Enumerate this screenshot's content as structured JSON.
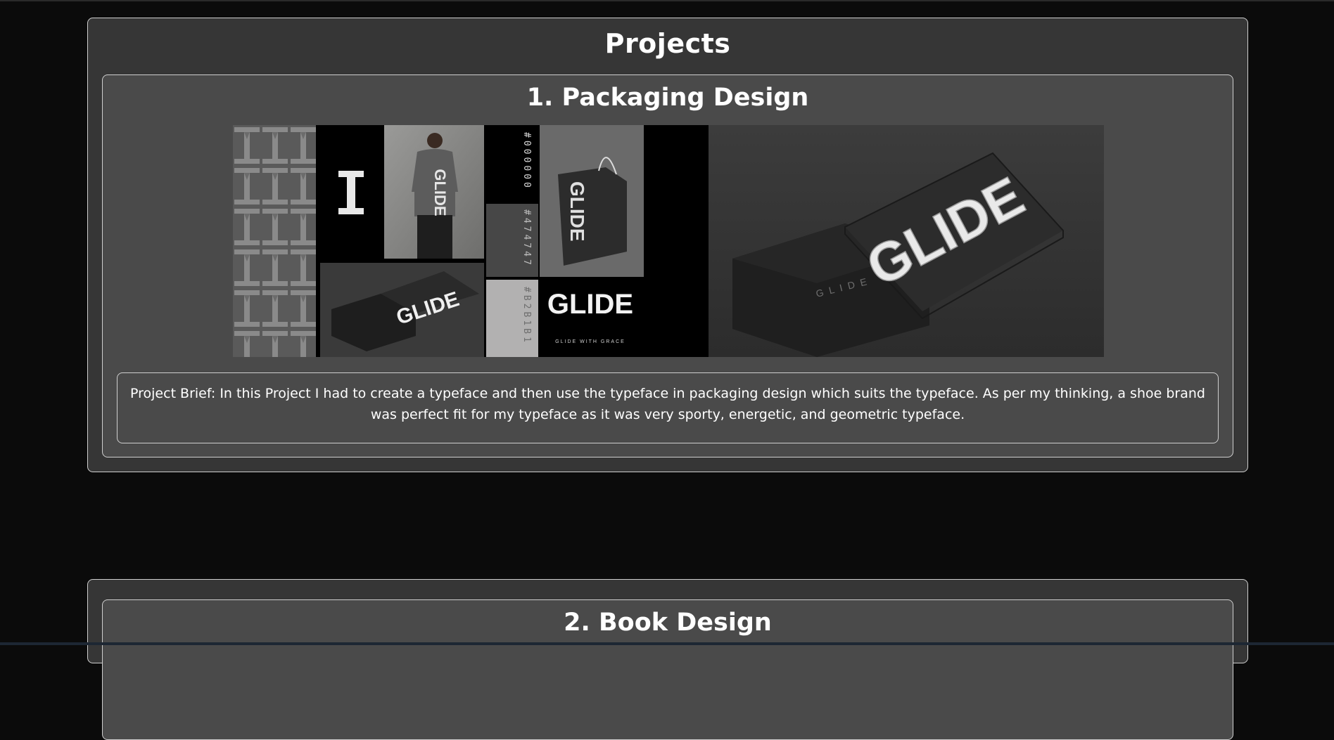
{
  "page": {
    "heading": "Projects"
  },
  "projects": [
    {
      "title": "1. Packaging Design",
      "brief": "Project Brief: In this Project I had to create a typeface and then use the typeface in packaging design which suits the typeface. As per my thinking, a shoe brand was perfect fit for my typeface as it was very sporty, energetic, and geometric typeface.",
      "gallery": {
        "logo_text": "GLIDE",
        "tagline": "GLIDE WITH GRACE",
        "box_text": "GLIDE",
        "swatches": [
          "#000000",
          "#474747",
          "#B2B1B1"
        ]
      }
    },
    {
      "title": "2. Book Design"
    }
  ],
  "colors": {
    "page_bg": "#0b0b0b",
    "section_bg": "#363636",
    "card_bg": "#4a4a4a",
    "border": "#cfcfcf"
  }
}
